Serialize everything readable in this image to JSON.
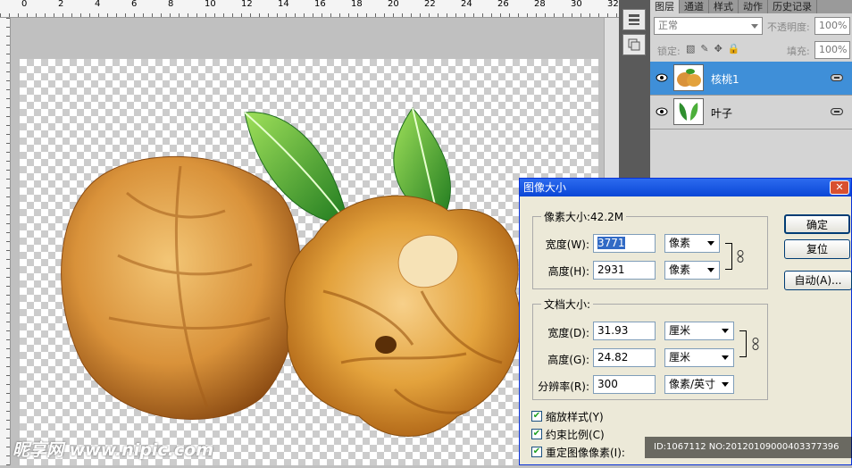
{
  "ruler": {
    "ticks": [
      "0",
      "2",
      "4",
      "6",
      "8",
      "10",
      "12",
      "14",
      "16",
      "18",
      "20",
      "22",
      "24",
      "26",
      "28",
      "30",
      "32"
    ]
  },
  "panel": {
    "tabs": [
      "图层",
      "通道",
      "样式",
      "动作",
      "历史记录"
    ],
    "blend_mode": "正常",
    "opacity_label": "不透明度:",
    "opacity_value": "100%",
    "lock_label": "锁定:",
    "fill_label": "填充:",
    "fill_value": "100%",
    "layers": [
      {
        "name": "核桃1",
        "selected": true
      },
      {
        "name": "叶子",
        "selected": false
      }
    ],
    "selected_color": "#3f8fd8"
  },
  "dialog": {
    "title": "图像大小",
    "pixel_group": "像素大小:42.2M",
    "pixel_width_label": "宽度(W):",
    "pixel_width_value": "3771",
    "pixel_width_unit": "像素",
    "pixel_height_label": "高度(H):",
    "pixel_height_value": "2931",
    "pixel_height_unit": "像素",
    "doc_group": "文档大小:",
    "doc_width_label": "宽度(D):",
    "doc_width_value": "31.93",
    "doc_width_unit": "厘米",
    "doc_height_label": "高度(G):",
    "doc_height_value": "24.82",
    "doc_height_unit": "厘米",
    "resolution_label": "分辨率(R):",
    "resolution_value": "300",
    "resolution_unit": "像素/英寸",
    "ok_button": "确定",
    "reset_button": "复位",
    "auto_button": "自动(A)...",
    "scale_styles": "缩放样式(Y)",
    "constrain": "约束比例(C)",
    "resample": "重定图像像素(I):"
  },
  "watermark": {
    "left": "昵享网 www.nipic.com",
    "right": "ID:1067112 NO:20120109000403377396"
  }
}
